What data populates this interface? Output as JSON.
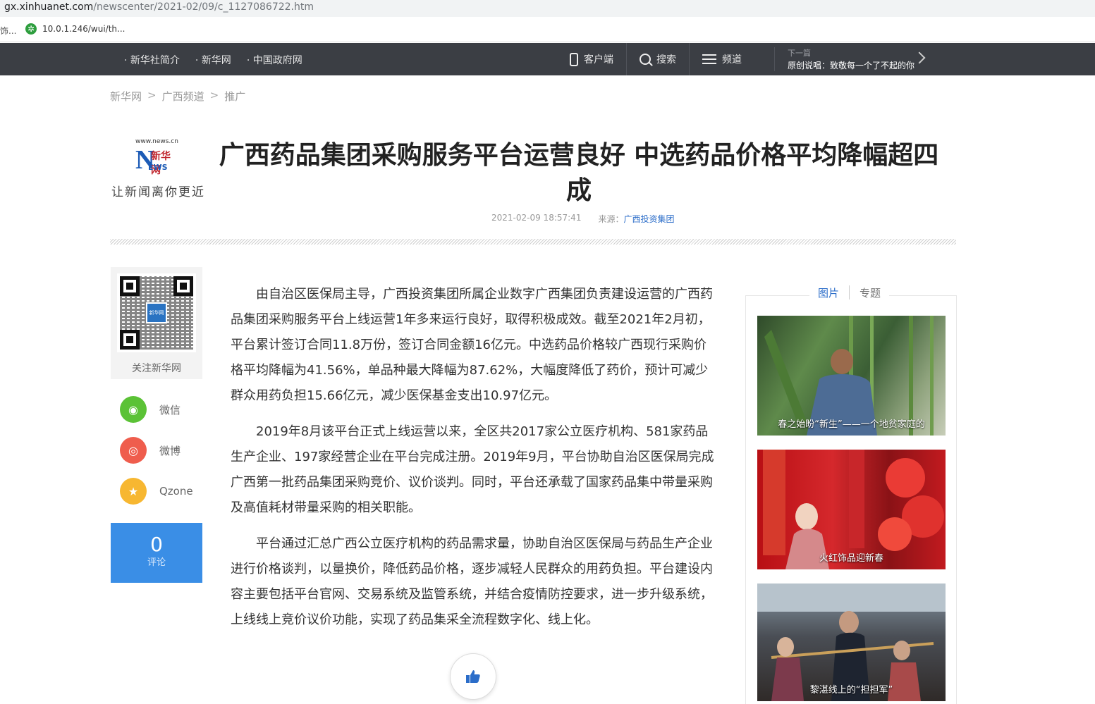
{
  "browser": {
    "url_host": "gx.xinhuanet.com",
    "url_path": "/newscenter/2021-02/09/c_1127086722.htm",
    "bookmark_fragment": "饰...",
    "bookmark_label": "10.0.1.246/wui/th..."
  },
  "topnav": {
    "links": [
      "新华社简介",
      "新华网",
      "中国政府网"
    ],
    "tools": [
      "客户端",
      "搜索",
      "频道"
    ],
    "next_label": "下一篇",
    "next_title": "原创说唱：致敬每一个了不起的你"
  },
  "breadcrumb": [
    "新华网",
    "广西频道",
    "推广"
  ],
  "breadcrumb_sep": ">",
  "logo": {
    "site": "www.news.cn",
    "letter": "N",
    "word": "EWS",
    "cn": "新华网",
    "slogan": "让新闻离你更近"
  },
  "article": {
    "title": "广西药品集团采购服务平台运营良好 中选药品价格平均降幅超四成",
    "datetime": "2021-02-09 18:57:41",
    "source_label": "来源：",
    "source": "广西投资集团",
    "paragraphs": [
      "由自治区医保局主导，广西投资集团所属企业数字广西集团负责建设运营的广西药品集团采购服务平台上线运营1年多来运行良好，取得积极成效。截至2021年2月初，平台累计签订合同11.8万份，签订合同金额16亿元。中选药品价格较广西现行采购价格平均降幅为41.56%，单品种最大降幅为87.62%，大幅度降低了药价，预计可减少群众用药负担15.66亿元，减少医保基金支出10.97亿元。",
      "2019年8月该平台正式上线运营以来，全区共2017家公立医疗机构、581家药品生产企业、197家经营企业在平台完成注册。2019年9月，平台协助自治区医保局完成广西第一批药品集团采购竞价、议价谈判。同时，平台还承载了国家药品集中带量采购及高值耗材带量采购的相关职能。",
      "平台通过汇总广西公立医疗机构的药品需求量，协助自治区医保局与药品生产企业进行价格谈判，以量换价，降低药品价格，逐步减轻人民群众的用药负担。平台建设内容主要包括平台官网、交易系统及监管系统，并结合疫情防控要求，进一步升级系统，上线线上竞价议价功能，实现了药品集采全流程数字化、线上化。"
    ]
  },
  "left_rail": {
    "qr_center": "新华网",
    "qr_label": "关注新华网",
    "share": [
      {
        "label": "微信",
        "color": "#5bc236",
        "icon": "wechat-icon"
      },
      {
        "label": "微博",
        "color": "#ef5d4d",
        "icon": "weibo-icon"
      },
      {
        "label": "Qzone",
        "color": "#f7b731",
        "icon": "qzone-star-icon"
      }
    ],
    "comment_count": "0",
    "comment_label": "评论"
  },
  "right_rail": {
    "tabs": [
      "图片",
      "专题"
    ],
    "pictures": [
      "春之始盼“新生”——一个地贫家庭的",
      "火红饰品迎新春",
      "黎湛线上的“担担军”"
    ]
  }
}
